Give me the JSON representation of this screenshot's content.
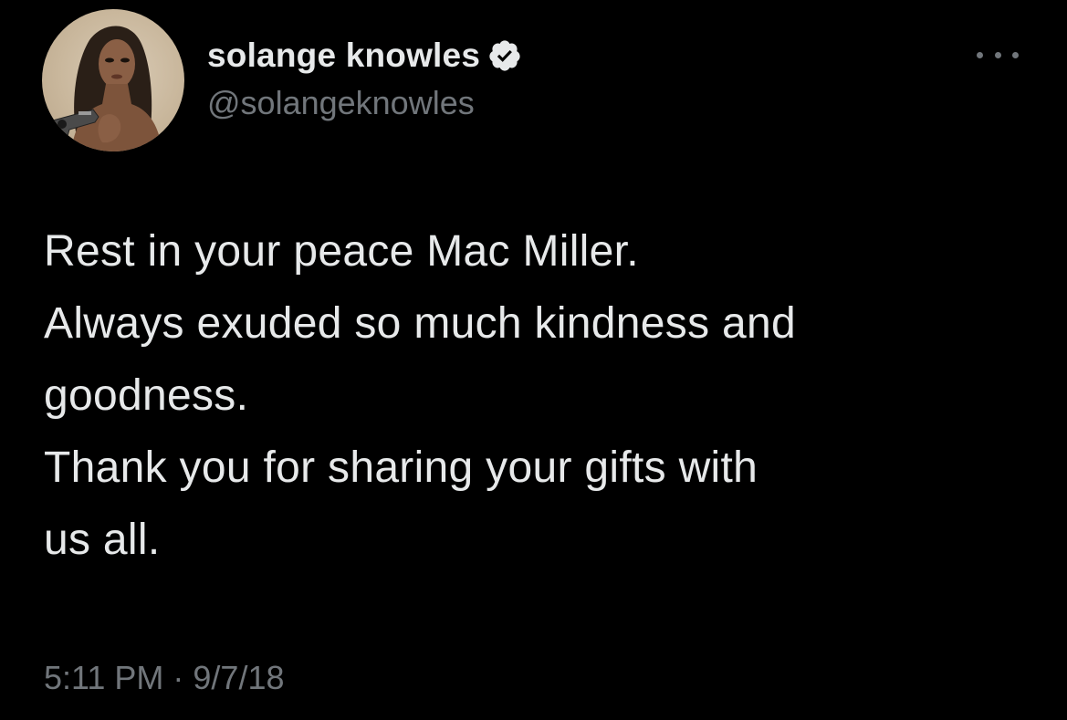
{
  "tweet": {
    "author": {
      "display_name": "solange knowles",
      "handle": "@solangeknowles",
      "verified": true,
      "verified_color": "#e7e9ea"
    },
    "more_icon": "more-horizontal-icon",
    "text_lines": [
      "Rest in your peace Mac Miller.",
      "Always exuded so much kindness and",
      "goodness.",
      "Thank you for sharing your gifts with",
      "us all."
    ],
    "time": "5:11 PM",
    "separator": " · ",
    "date": "9/7/18"
  },
  "theme": {
    "background": "#000000",
    "primary_text": "#e7e9ea",
    "secondary_text": "#71767b"
  }
}
